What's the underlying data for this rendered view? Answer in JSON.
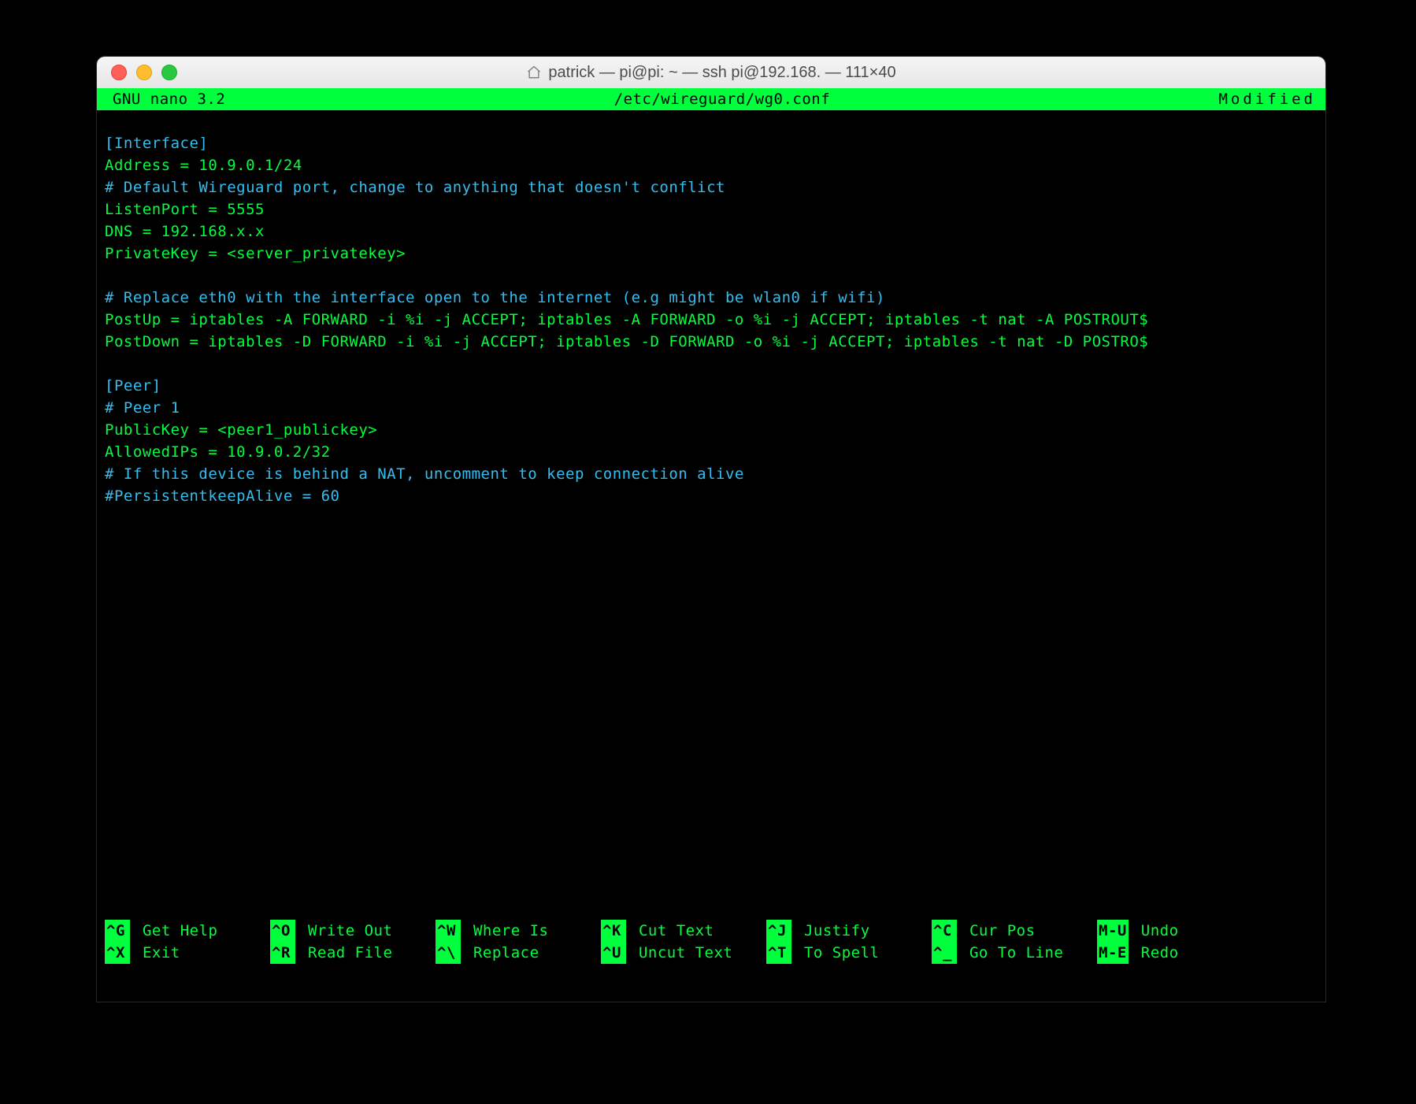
{
  "window": {
    "title": "patrick — pi@pi: ~ — ssh pi@192.168.      — 111×40"
  },
  "nano": {
    "app": "GNU nano 3.2",
    "filepath": "/etc/wireguard/wg0.conf",
    "status": "Modified"
  },
  "lines": [
    {
      "cls": "blank",
      "text": ""
    },
    {
      "cls": "cyan",
      "text": "[Interface]"
    },
    {
      "cls": "green",
      "text": "Address = 10.9.0.1/24"
    },
    {
      "cls": "cyan",
      "text": "# Default Wireguard port, change to anything that doesn't conflict"
    },
    {
      "cls": "green",
      "text": "ListenPort = 5555"
    },
    {
      "cls": "green",
      "text": "DNS = 192.168.x.x"
    },
    {
      "cls": "green",
      "text": "PrivateKey = <server_privatekey>"
    },
    {
      "cls": "blank",
      "text": ""
    },
    {
      "cls": "cyan",
      "text": "# Replace eth0 with the interface open to the internet (e.g might be wlan0 if wifi)"
    },
    {
      "cls": "green",
      "text": "PostUp = iptables -A FORWARD -i %i -j ACCEPT; iptables -A FORWARD -o %i -j ACCEPT; iptables -t nat -A POSTROUT$"
    },
    {
      "cls": "green",
      "text": "PostDown = iptables -D FORWARD -i %i -j ACCEPT; iptables -D FORWARD -o %i -j ACCEPT; iptables -t nat -D POSTRO$"
    },
    {
      "cls": "blank",
      "text": ""
    },
    {
      "cls": "cyan",
      "text": "[Peer]"
    },
    {
      "cls": "cyan",
      "text": "# Peer 1"
    },
    {
      "cls": "green",
      "text": "PublicKey = <peer1_publickey>"
    },
    {
      "cls": "green",
      "text": "AllowedIPs = 10.9.0.2/32"
    },
    {
      "cls": "cyan",
      "text": "# If this device is behind a NAT, uncomment to keep connection alive"
    },
    {
      "cls": "cyan",
      "text": "#PersistentkeepAlive = 60"
    }
  ],
  "shortcuts_row1": [
    {
      "key": "^G",
      "label": "Get Help"
    },
    {
      "key": "^O",
      "label": "Write Out"
    },
    {
      "key": "^W",
      "label": "Where Is"
    },
    {
      "key": "^K",
      "label": "Cut Text"
    },
    {
      "key": "^J",
      "label": "Justify"
    },
    {
      "key": "^C",
      "label": "Cur Pos"
    },
    {
      "key": "M-U",
      "label": "Undo"
    }
  ],
  "shortcuts_row2": [
    {
      "key": "^X",
      "label": "Exit"
    },
    {
      "key": "^R",
      "label": "Read File"
    },
    {
      "key": "^\\",
      "label": "Replace"
    },
    {
      "key": "^U",
      "label": "Uncut Text"
    },
    {
      "key": "^T",
      "label": "To Spell"
    },
    {
      "key": "^_",
      "label": "Go To Line"
    },
    {
      "key": "M-E",
      "label": "Redo"
    }
  ]
}
